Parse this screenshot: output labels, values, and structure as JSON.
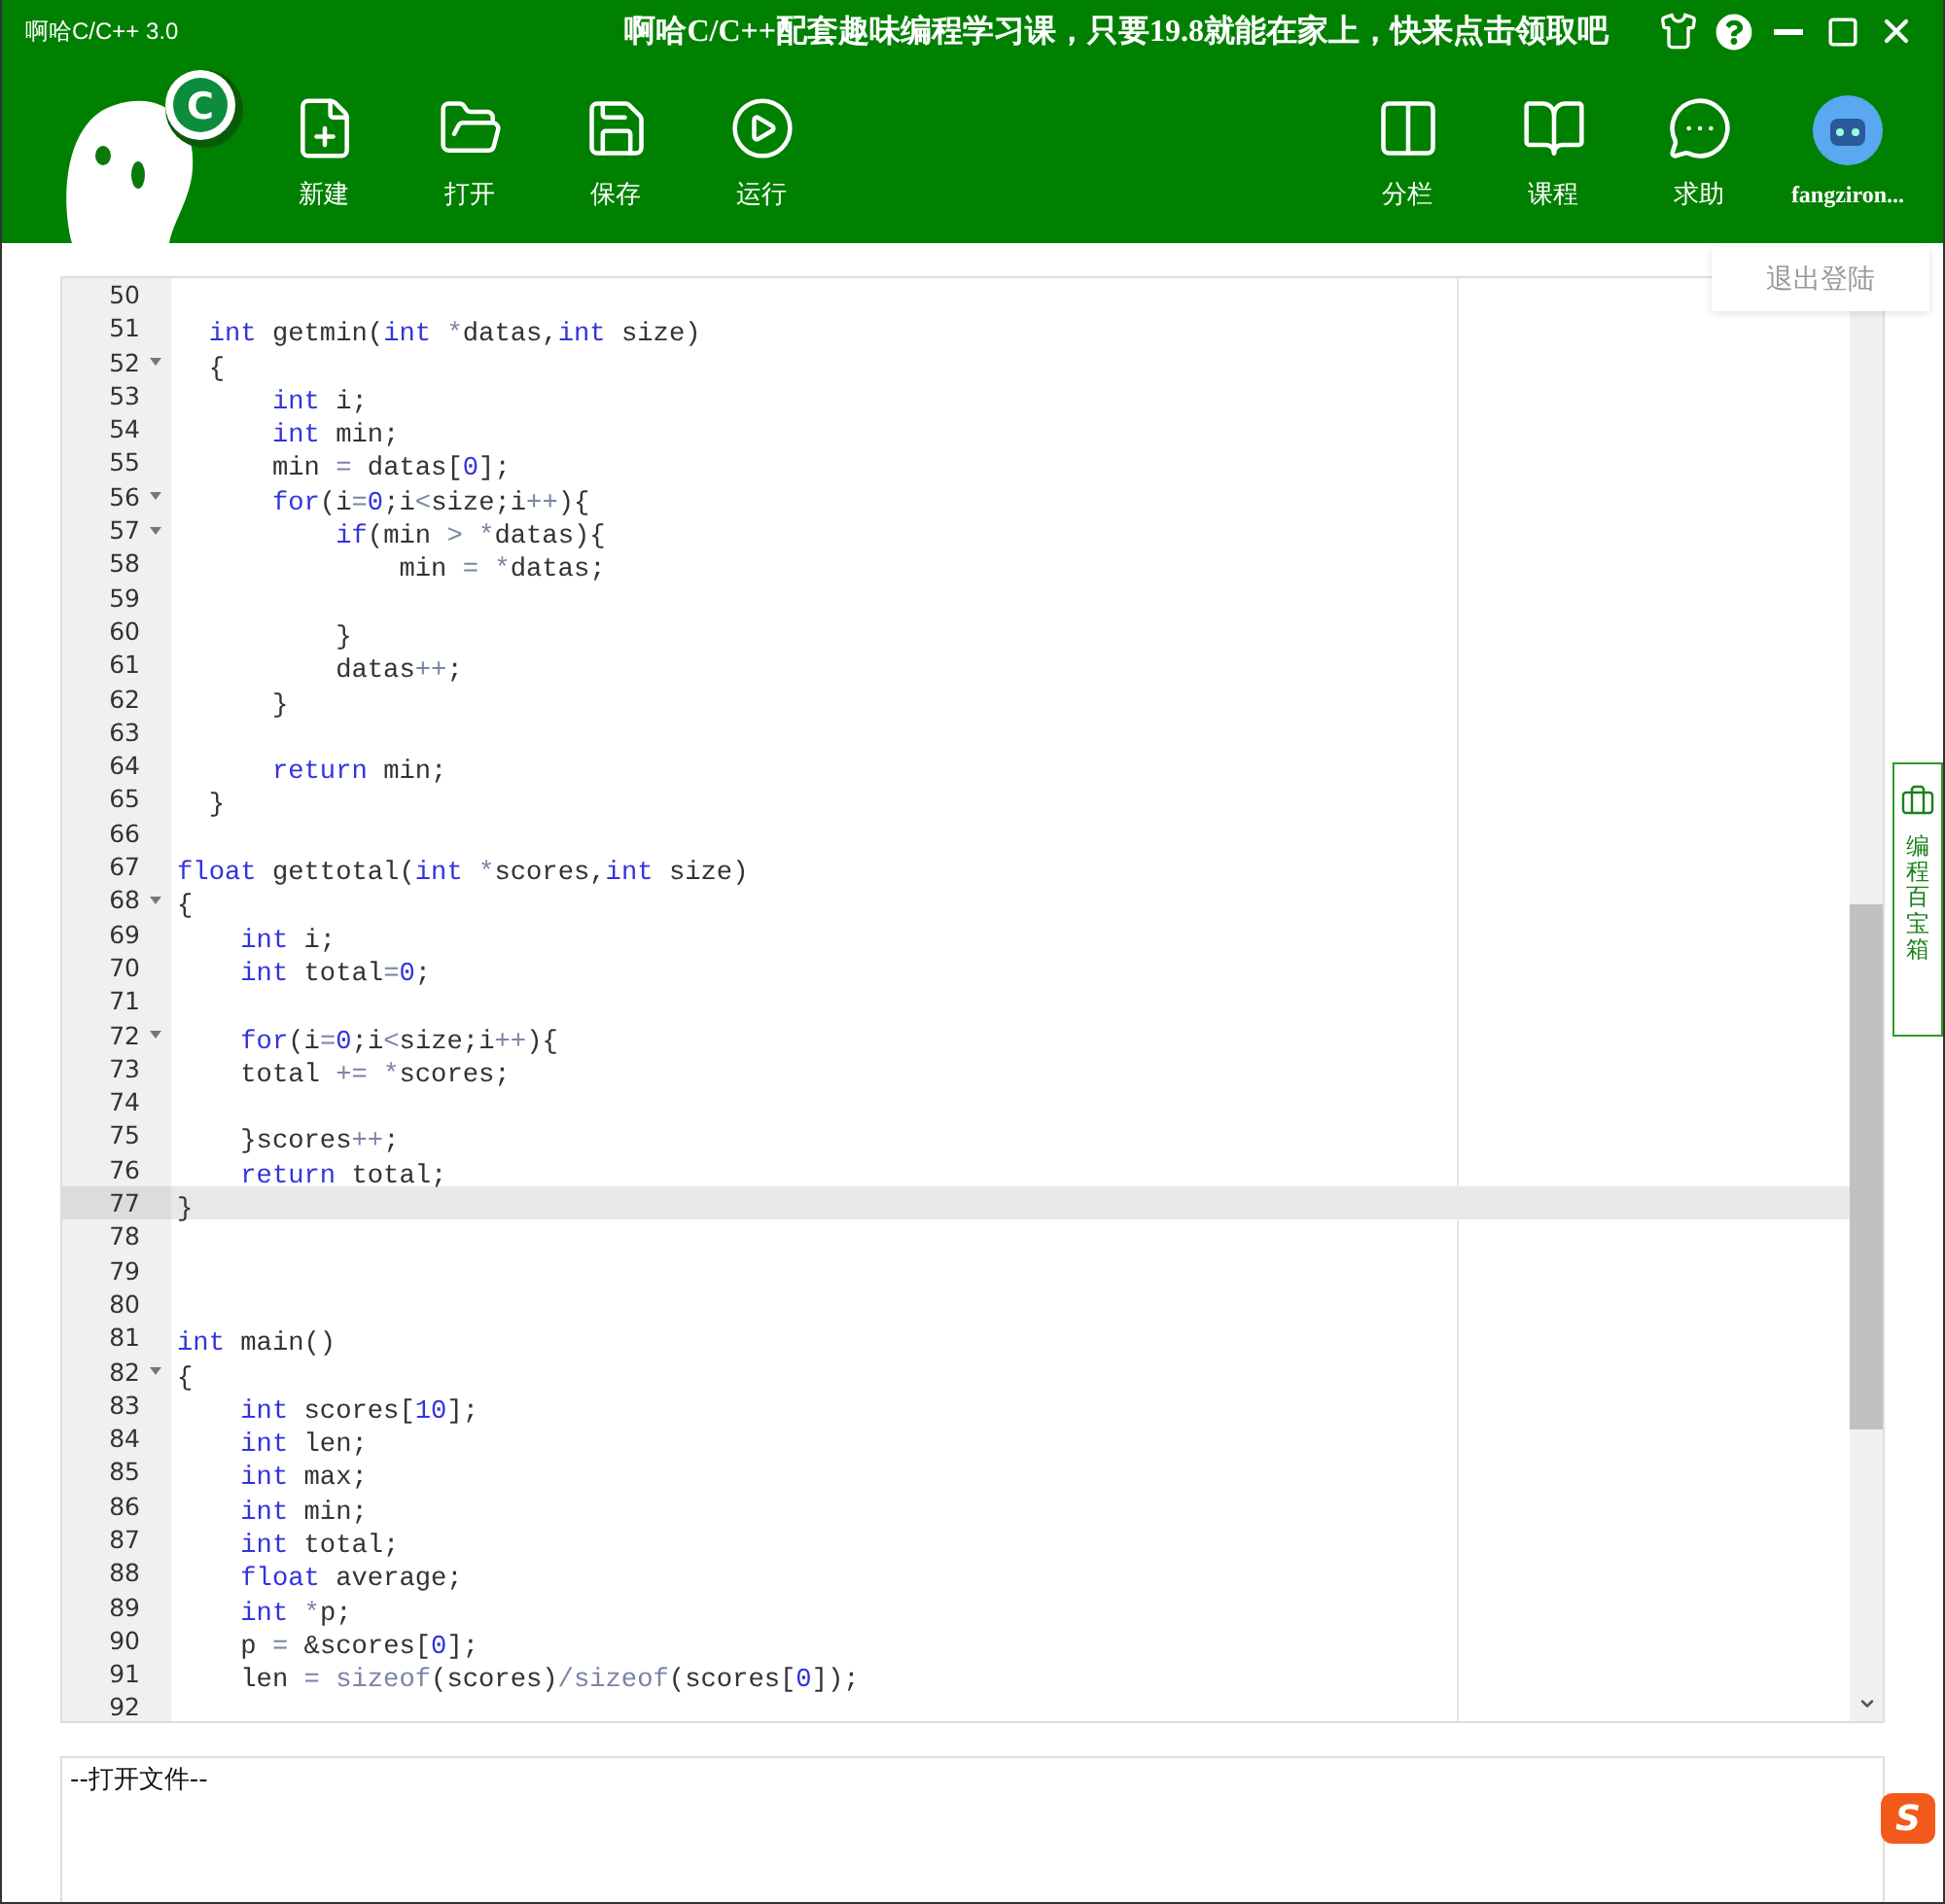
{
  "window": {
    "title": "啊哈C/C++ 3.0",
    "promo": "啊哈C/C++配套趣味编程学习课，只要19.8就能在家上，快来点击领取吧"
  },
  "logo": {
    "letter": "C"
  },
  "toolbar_left": [
    {
      "label": "新建"
    },
    {
      "label": "打开"
    },
    {
      "label": "保存"
    },
    {
      "label": "运行"
    }
  ],
  "toolbar_right": [
    {
      "label": "分栏"
    },
    {
      "label": "课程"
    },
    {
      "label": "求助"
    }
  ],
  "user": {
    "name": "fangziron..."
  },
  "user_menu": {
    "item": "退出登陆"
  },
  "editor": {
    "lines": [
      {
        "n": "50",
        "fold": false,
        "selected": false
      },
      {
        "n": "51",
        "fold": false,
        "selected": false,
        "tokens": [
          {
            "kind": "kw",
            "text": "  int"
          },
          {
            "kind": "t",
            "text": " getmin("
          },
          {
            "kind": "kw",
            "text": "int"
          },
          {
            "kind": "op",
            "text": " *"
          },
          {
            "kind": "t",
            "text": "datas,"
          },
          {
            "kind": "kw",
            "text": "int"
          },
          {
            "kind": "t",
            "text": " size)"
          }
        ]
      },
      {
        "n": "52",
        "fold": true,
        "selected": false,
        "tokens": [
          {
            "kind": "t",
            "text": "  {"
          }
        ]
      },
      {
        "n": "53",
        "fold": false,
        "selected": false,
        "tokens": [
          {
            "kind": "kw",
            "text": "      int"
          },
          {
            "kind": "t",
            "text": " i;"
          }
        ]
      },
      {
        "n": "54",
        "fold": false,
        "selected": false,
        "tokens": [
          {
            "kind": "kw",
            "text": "      int"
          },
          {
            "kind": "t",
            "text": " min;"
          }
        ]
      },
      {
        "n": "55",
        "fold": false,
        "selected": false,
        "tokens": [
          {
            "kind": "t",
            "text": "      min "
          },
          {
            "kind": "op",
            "text": "="
          },
          {
            "kind": "t",
            "text": " datas["
          },
          {
            "kind": "num",
            "text": "0"
          },
          {
            "kind": "t",
            "text": "];"
          }
        ]
      },
      {
        "n": "56",
        "fold": true,
        "selected": false,
        "tokens": [
          {
            "kind": "kw",
            "text": "      for"
          },
          {
            "kind": "t",
            "text": "(i"
          },
          {
            "kind": "op",
            "text": "="
          },
          {
            "kind": "num",
            "text": "0"
          },
          {
            "kind": "t",
            "text": ";i"
          },
          {
            "kind": "op",
            "text": "<"
          },
          {
            "kind": "t",
            "text": "size;i"
          },
          {
            "kind": "op",
            "text": "++"
          },
          {
            "kind": "t",
            "text": "){"
          }
        ]
      },
      {
        "n": "57",
        "fold": true,
        "selected": false,
        "tokens": [
          {
            "kind": "kw",
            "text": "          if"
          },
          {
            "kind": "t",
            "text": "(min "
          },
          {
            "kind": "op",
            "text": "> *"
          },
          {
            "kind": "t",
            "text": "datas){"
          }
        ]
      },
      {
        "n": "58",
        "fold": false,
        "selected": false,
        "tokens": [
          {
            "kind": "t",
            "text": "              min "
          },
          {
            "kind": "op",
            "text": "= *"
          },
          {
            "kind": "t",
            "text": "datas;"
          }
        ]
      },
      {
        "n": "59",
        "fold": false,
        "selected": false
      },
      {
        "n": "60",
        "fold": false,
        "selected": false,
        "tokens": [
          {
            "kind": "t",
            "text": "          }"
          }
        ]
      },
      {
        "n": "61",
        "fold": false,
        "selected": false,
        "tokens": [
          {
            "kind": "t",
            "text": "          datas"
          },
          {
            "kind": "op",
            "text": "++"
          },
          {
            "kind": "t",
            "text": ";"
          }
        ]
      },
      {
        "n": "62",
        "fold": false,
        "selected": false,
        "tokens": [
          {
            "kind": "t",
            "text": "      }"
          }
        ]
      },
      {
        "n": "63",
        "fold": false,
        "selected": false
      },
      {
        "n": "64",
        "fold": false,
        "selected": false,
        "tokens": [
          {
            "kind": "kw",
            "text": "      return"
          },
          {
            "kind": "t",
            "text": " min;"
          }
        ]
      },
      {
        "n": "65",
        "fold": false,
        "selected": false,
        "tokens": [
          {
            "kind": "t",
            "text": "  }"
          }
        ]
      },
      {
        "n": "66",
        "fold": false,
        "selected": false
      },
      {
        "n": "67",
        "fold": false,
        "selected": false,
        "tokens": [
          {
            "kind": "kw",
            "text": "float"
          },
          {
            "kind": "t",
            "text": " gettotal("
          },
          {
            "kind": "kw",
            "text": "int"
          },
          {
            "kind": "op",
            "text": " *"
          },
          {
            "kind": "t",
            "text": "scores,"
          },
          {
            "kind": "kw",
            "text": "int"
          },
          {
            "kind": "t",
            "text": " size)"
          }
        ]
      },
      {
        "n": "68",
        "fold": true,
        "selected": false,
        "tokens": [
          {
            "kind": "t",
            "text": "{"
          }
        ]
      },
      {
        "n": "69",
        "fold": false,
        "selected": false,
        "tokens": [
          {
            "kind": "kw",
            "text": "    int"
          },
          {
            "kind": "t",
            "text": " i;"
          }
        ]
      },
      {
        "n": "70",
        "fold": false,
        "selected": false,
        "tokens": [
          {
            "kind": "kw",
            "text": "    int"
          },
          {
            "kind": "t",
            "text": " total"
          },
          {
            "kind": "op",
            "text": "="
          },
          {
            "kind": "num",
            "text": "0"
          },
          {
            "kind": "t",
            "text": ";"
          }
        ]
      },
      {
        "n": "71",
        "fold": false,
        "selected": false
      },
      {
        "n": "72",
        "fold": true,
        "selected": false,
        "tokens": [
          {
            "kind": "kw",
            "text": "    for"
          },
          {
            "kind": "t",
            "text": "(i"
          },
          {
            "kind": "op",
            "text": "="
          },
          {
            "kind": "num",
            "text": "0"
          },
          {
            "kind": "t",
            "text": ";i"
          },
          {
            "kind": "op",
            "text": "<"
          },
          {
            "kind": "t",
            "text": "size;i"
          },
          {
            "kind": "op",
            "text": "++"
          },
          {
            "kind": "t",
            "text": "){"
          }
        ]
      },
      {
        "n": "73",
        "fold": false,
        "selected": false,
        "tokens": [
          {
            "kind": "t",
            "text": "    total "
          },
          {
            "kind": "op",
            "text": "+= *"
          },
          {
            "kind": "t",
            "text": "scores;"
          }
        ]
      },
      {
        "n": "74",
        "fold": false,
        "selected": false
      },
      {
        "n": "75",
        "fold": false,
        "selected": false,
        "tokens": [
          {
            "kind": "t",
            "text": "    }scores"
          },
          {
            "kind": "op",
            "text": "++"
          },
          {
            "kind": "t",
            "text": ";"
          }
        ]
      },
      {
        "n": "76",
        "fold": false,
        "selected": false,
        "tokens": [
          {
            "kind": "kw",
            "text": "    return"
          },
          {
            "kind": "t",
            "text": " total;"
          }
        ]
      },
      {
        "n": "77",
        "fold": false,
        "selected": true,
        "tokens": [
          {
            "kind": "t",
            "text": "}"
          }
        ]
      },
      {
        "n": "78",
        "fold": false,
        "selected": false
      },
      {
        "n": "79",
        "fold": false,
        "selected": false
      },
      {
        "n": "80",
        "fold": false,
        "selected": false
      },
      {
        "n": "81",
        "fold": false,
        "selected": false,
        "tokens": [
          {
            "kind": "kw",
            "text": "int"
          },
          {
            "kind": "t",
            "text": " main()"
          }
        ]
      },
      {
        "n": "82",
        "fold": true,
        "selected": false,
        "tokens": [
          {
            "kind": "t",
            "text": "{"
          }
        ]
      },
      {
        "n": "83",
        "fold": false,
        "selected": false,
        "tokens": [
          {
            "kind": "kw",
            "text": "    int"
          },
          {
            "kind": "t",
            "text": " scores["
          },
          {
            "kind": "num",
            "text": "10"
          },
          {
            "kind": "t",
            "text": "];"
          }
        ]
      },
      {
        "n": "84",
        "fold": false,
        "selected": false,
        "tokens": [
          {
            "kind": "kw",
            "text": "    int"
          },
          {
            "kind": "t",
            "text": " len;"
          }
        ]
      },
      {
        "n": "85",
        "fold": false,
        "selected": false,
        "tokens": [
          {
            "kind": "kw",
            "text": "    int"
          },
          {
            "kind": "t",
            "text": " max;"
          }
        ]
      },
      {
        "n": "86",
        "fold": false,
        "selected": false,
        "tokens": [
          {
            "kind": "kw",
            "text": "    int"
          },
          {
            "kind": "t",
            "text": " min;"
          }
        ]
      },
      {
        "n": "87",
        "fold": false,
        "selected": false,
        "tokens": [
          {
            "kind": "kw",
            "text": "    int"
          },
          {
            "kind": "t",
            "text": " total;"
          }
        ]
      },
      {
        "n": "88",
        "fold": false,
        "selected": false,
        "tokens": [
          {
            "kind": "kw",
            "text": "    float"
          },
          {
            "kind": "t",
            "text": " average;"
          }
        ]
      },
      {
        "n": "89",
        "fold": false,
        "selected": false,
        "tokens": [
          {
            "kind": "kw",
            "text": "    int"
          },
          {
            "kind": "op",
            "text": " *"
          },
          {
            "kind": "t",
            "text": "p;"
          }
        ]
      },
      {
        "n": "90",
        "fold": false,
        "selected": false,
        "tokens": [
          {
            "kind": "t",
            "text": "    p "
          },
          {
            "kind": "op",
            "text": "="
          },
          {
            "kind": "t",
            "text": " &scores["
          },
          {
            "kind": "num",
            "text": "0"
          },
          {
            "kind": "t",
            "text": "];"
          }
        ]
      },
      {
        "n": "91",
        "fold": false,
        "selected": false,
        "tokens": [
          {
            "kind": "t",
            "text": "    len "
          },
          {
            "kind": "op",
            "text": "= sizeof"
          },
          {
            "kind": "t",
            "text": "(scores)"
          },
          {
            "kind": "op",
            "text": "/sizeof"
          },
          {
            "kind": "t",
            "text": "(scores["
          },
          {
            "kind": "num",
            "text": "0"
          },
          {
            "kind": "t",
            "text": "]);"
          }
        ]
      },
      {
        "n": "92",
        "fold": false,
        "selected": false
      }
    ]
  },
  "side_tab": {
    "label": "编程百宝箱"
  },
  "output": {
    "text": "--打开文件--"
  },
  "ime_badge": {
    "letter": "S"
  }
}
